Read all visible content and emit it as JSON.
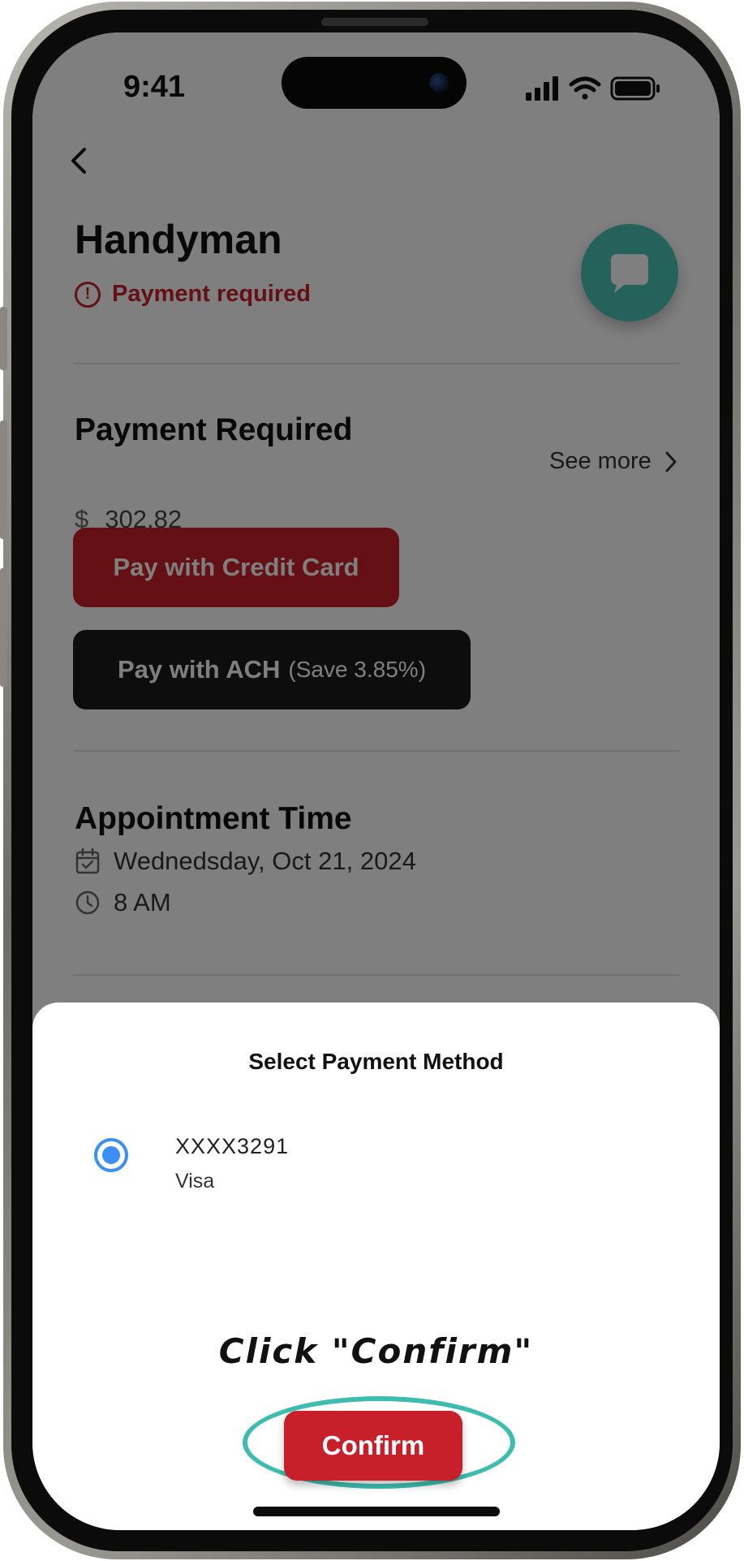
{
  "status_bar": {
    "time": "9:41"
  },
  "header": {
    "back_icon": "chevron-left-icon",
    "title": "Handyman",
    "alert_text": "Payment required"
  },
  "payment": {
    "section_title": "Payment Required",
    "see_more": "See more",
    "currency": "$",
    "amount": "302.82",
    "credit_card_label": "Pay with Credit Card",
    "ach_label": "Pay with ACH",
    "ach_save_label": "(Save 3.85%)"
  },
  "appointment": {
    "section_title": "Appointment Time",
    "date": "Wednedsday, Oct 21, 2024",
    "time": "8 AM"
  },
  "sheet": {
    "title": "Select Payment Method",
    "card_number": "XXXX3291",
    "card_brand": "Visa",
    "confirm_label": "Confirm"
  },
  "annotation": {
    "hint": "Click \"Confirm\""
  },
  "colors": {
    "brand_red": "#c8202b",
    "teal": "#48c5b6",
    "radio_blue": "#3c8ef5",
    "ring_teal": "#3cbdb0"
  }
}
